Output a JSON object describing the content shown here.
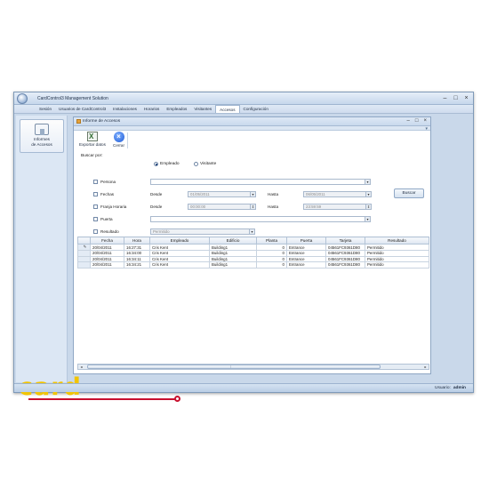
{
  "window": {
    "title": "CardControl3  Management Solution",
    "controls": [
      "–",
      "□",
      "×"
    ]
  },
  "menu": {
    "items": [
      "Sesión",
      "Usuarios de CardControl3",
      "Instalaciones",
      "Horarios",
      "Empleados",
      "Visitantes",
      "Accesos",
      "Configuración"
    ],
    "active": "Accesos"
  },
  "sidebar": {
    "button_label_1": "Informes",
    "button_label_2": "de Accesos",
    "brand": "card"
  },
  "child_window": {
    "title": "Informe de Accesos",
    "controls": [
      "–",
      "□",
      "×"
    ]
  },
  "toolbar": {
    "export_label": "Exportar datos",
    "close_label": "Cerrar"
  },
  "filters": {
    "buscar_por": "Buscar por:",
    "radio_empleado": "Empleado",
    "radio_visitante": "Visitante",
    "persona": "Persona",
    "fechas": "Fechas",
    "franja": "Franja Horaria",
    "puerta": "Puerta",
    "resultado": "Resultado",
    "desde": "Desde",
    "hasta": "Hasta",
    "fecha_desde": "01/05/2011",
    "fecha_hasta": "06/05/2011",
    "hora_desde": "00:00:00",
    "hora_hasta": "23:59:59",
    "resultado_value": "Permitido",
    "buscar_button": "Buscar"
  },
  "table": {
    "columns": [
      "Fecha",
      "Hora",
      "Empleado",
      "Edificio",
      "Planta",
      "Puerta",
      "Tarjeta",
      "Resultado"
    ],
    "rows": [
      [
        "20/04/2011",
        "16:27:31",
        "Cris Kent",
        "Building1",
        "0",
        "Entrance",
        "04561FC9361D80",
        "Permitido"
      ],
      [
        "20/04/2011",
        "16:34:00",
        "Cris Kent",
        "Building1",
        "0",
        "Entrance",
        "04561FC9361D80",
        "Permitido"
      ],
      [
        "20/04/2011",
        "16:34:11",
        "Cris Kent",
        "Building1",
        "0",
        "Entrance",
        "04561FC9361D80",
        "Permitido"
      ],
      [
        "20/04/2011",
        "16:34:21",
        "Cris Kent",
        "Building1",
        "0",
        "Entrance",
        "04561FC9361D80",
        "Permitido"
      ]
    ]
  },
  "status": {
    "user_label": "Usuario:",
    "user_name": "admin"
  },
  "colors": {
    "brand_yellow": "#f2c400",
    "brand_red": "#c8102e",
    "chrome_blue": "#c9d8ea"
  }
}
